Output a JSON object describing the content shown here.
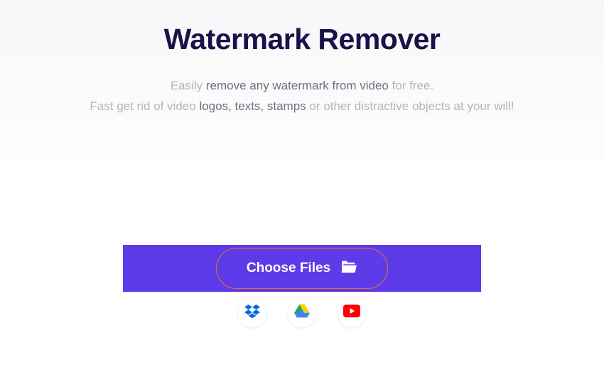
{
  "hero": {
    "title": "Watermark Remover",
    "line1_pre": "Easily ",
    "line1_bold": "remove any watermark from video",
    "line1_post": " for free.",
    "line2_pre": "Fast get rid of video ",
    "line2_bold": "logos, texts, stamps",
    "line2_post": " or other distractive objects at your will!"
  },
  "upload": {
    "choose_label": "Choose Files",
    "sources": {
      "dropbox": "Dropbox",
      "gdrive": "Google Drive",
      "youtube": "YouTube"
    }
  }
}
